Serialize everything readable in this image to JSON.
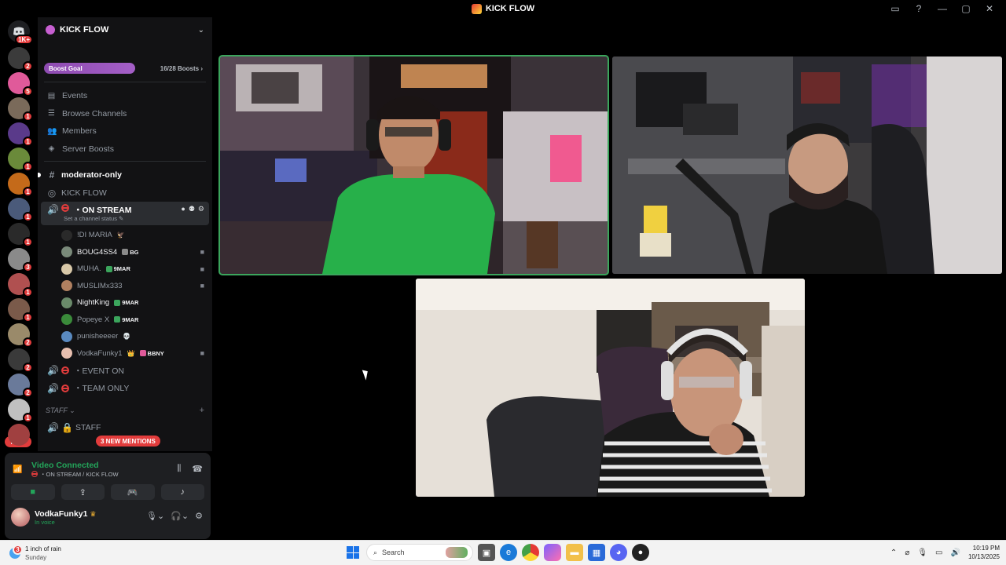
{
  "window": {
    "title": "KICK FLOW"
  },
  "server_rail": {
    "new_label": "NEW",
    "home_badge": "1K+",
    "servers": [
      {
        "color": "#3b3b3b",
        "badge": "2"
      },
      {
        "color": "#e05a9a",
        "badge": "5"
      },
      {
        "color": "#7a6a5a",
        "badge": "1"
      },
      {
        "color": "#5a3a8a",
        "badge": "1"
      },
      {
        "color": "#6a8a3a",
        "badge": "1"
      },
      {
        "color": "#c46a1a",
        "badge": "1"
      },
      {
        "color": "#4a5a7a",
        "badge": "1"
      },
      {
        "color": "#2a2a2a",
        "badge": "1"
      },
      {
        "color": "#8a8a8a",
        "badge": "3"
      },
      {
        "color": "#b05050",
        "badge": "1"
      },
      {
        "color": "#7a5a4a",
        "badge": "1"
      },
      {
        "color": "#9a8a6a",
        "badge": "2"
      },
      {
        "color": "#3a3a3a",
        "badge": "2"
      },
      {
        "color": "#6a7a9a",
        "badge": "2"
      },
      {
        "color": "#c0c0c0",
        "badge": "1"
      },
      {
        "color": "#a04040",
        "badge": ""
      }
    ]
  },
  "sidebar": {
    "server_name": "KICK FLOW",
    "boost_goal_label": "Boost Goal",
    "boost_count": "16/28 Boosts",
    "nav": [
      {
        "icon": "calendar-icon",
        "glyph": "▤",
        "label": "Events"
      },
      {
        "icon": "browse-channels-icon",
        "glyph": "☰",
        "label": "Browse Channels"
      },
      {
        "icon": "members-icon",
        "glyph": "👥",
        "label": "Members"
      },
      {
        "icon": "boost-icon",
        "glyph": "◈",
        "label": "Server Boosts"
      }
    ],
    "channels": {
      "moderator_only": "moderator-only",
      "kick_flow": "KICK FLOW",
      "on_stream": "・ON STREAM",
      "on_stream_status": "Set a channel status",
      "event_on": "・EVENT ON",
      "team_only": "・TEAM ONLY"
    },
    "voice_users": [
      {
        "name": "!DI MARIA",
        "tag": "",
        "extra": "🦅",
        "bright": false,
        "cam": false,
        "color": "#2a2a2a"
      },
      {
        "name": "BOUG4SS4",
        "tag": "BG",
        "extra": "",
        "bright": true,
        "cam": true,
        "color": "#7a8a7a"
      },
      {
        "name": "MUHA.",
        "tag": "9MAR",
        "extra": "",
        "bright": false,
        "cam": true,
        "color": "#d8c8a8"
      },
      {
        "name": "MUSLIMx333",
        "tag": "",
        "extra": "",
        "bright": false,
        "cam": true,
        "color": "#b08060"
      },
      {
        "name": "NightKing",
        "tag": "9MAR",
        "extra": "",
        "bright": true,
        "cam": false,
        "color": "#6a8a6a"
      },
      {
        "name": "Popeye X",
        "tag": "9MAR",
        "extra": "",
        "bright": false,
        "cam": false,
        "color": "#3a8a3a"
      },
      {
        "name": "punisheeeer",
        "tag": "",
        "extra": "💀",
        "bright": false,
        "cam": false,
        "color": "#5a8ac0"
      },
      {
        "name": "VodkaFunky1",
        "tag": "BBNY",
        "extra": "👑",
        "bright": false,
        "cam": true,
        "color": "#e8c0b0"
      }
    ],
    "staff_category": "STAFF",
    "staff_channel": "STAFF",
    "mentions_pill": "3 NEW MENTIONS"
  },
  "voice_panel": {
    "status": "Video Connected",
    "location": "・ON STREAM / KICK FLOW",
    "username": "VodkaFunky1",
    "user_status": "In voice"
  },
  "taskbar": {
    "weather_title": "1 inch of rain",
    "weather_sub": "Sunday",
    "weather_badge": "3",
    "search_placeholder": "Search",
    "time": "10:19 PM",
    "date": "10/13/2025"
  }
}
